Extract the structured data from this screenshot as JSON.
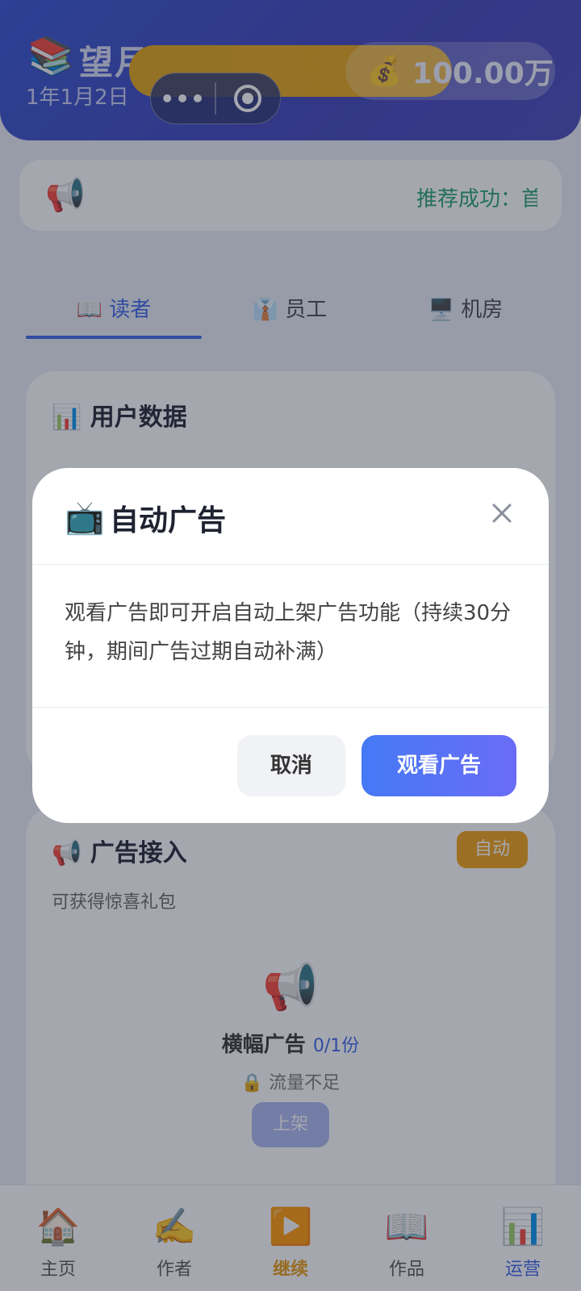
{
  "header": {
    "app_logo": "📚",
    "app_title": "望月阅读",
    "date": "1年1月2日",
    "money_icon": "💰",
    "money": "100.00万",
    "capsule": {
      "more_icon": "more-dots-icon",
      "close_icon": "target-icon"
    }
  },
  "notice": {
    "icon": "📢",
    "text": "推荐成功：首"
  },
  "tabs": [
    {
      "label": "📖 读者",
      "active": true
    },
    {
      "label": "👔 员工",
      "active": false
    },
    {
      "label": "🖥️ 机房",
      "active": false
    }
  ],
  "user_card": {
    "title": "📊 用户数据"
  },
  "ad_card": {
    "title": "📢 广告接入",
    "badge": "自动",
    "subtitle": "可获得惊喜礼包",
    "ad_icon": "📢",
    "ad_name": "横幅广告",
    "ad_count": "0/1份",
    "lock_text": "🔒 流量不足",
    "button": "上架"
  },
  "bottom_nav": [
    {
      "icon": "🏠",
      "label": "主页"
    },
    {
      "icon": "✍️",
      "label": "作者"
    },
    {
      "icon": "▶️",
      "label": "继续"
    },
    {
      "icon": "📖",
      "label": "作品"
    },
    {
      "icon": "📊",
      "label": "运营"
    }
  ],
  "dialog": {
    "icon": "📺",
    "title": "自动广告",
    "body": "观看广告即可开启自动上架广告功能（持续30分钟，期间广告过期自动补满）",
    "cancel": "取消",
    "confirm": "观看广告"
  },
  "colors": {
    "header_bg": "#3346c3",
    "accent_blue": "#3663e6",
    "gold": "#e0a412",
    "notice_green": "#22a06b",
    "auto_badge": "#f0a010"
  }
}
